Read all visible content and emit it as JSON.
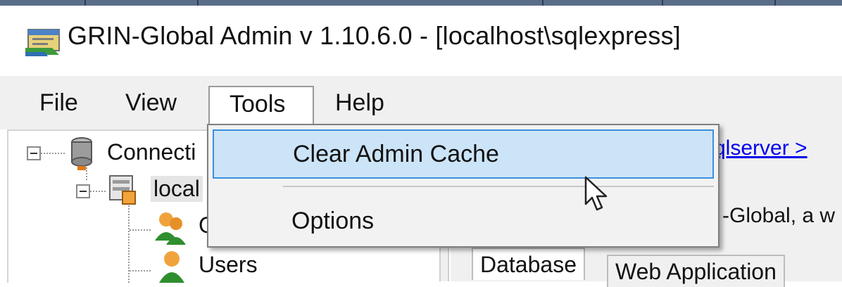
{
  "window": {
    "title": "GRIN-Global Admin v 1.10.6.0 - [localhost\\sqlexpress]"
  },
  "menubar": {
    "file": "File",
    "view": "View",
    "tools": "Tools",
    "help": "Help"
  },
  "tools_menu": {
    "items": [
      {
        "label": "Clear Admin Cache"
      },
      {
        "label": "Options"
      }
    ]
  },
  "tree": {
    "connections": "Connecti",
    "localhost": "local",
    "group_partial": "G",
    "users": "Users"
  },
  "right_panel": {
    "link": "qlserver >",
    "info": "-Global, a w",
    "tabs": [
      {
        "label": "Database"
      },
      {
        "label": "Web Application"
      }
    ]
  },
  "colors": {
    "highlight_bg": "#cce4f7",
    "highlight_border": "#3d8ee0",
    "menubar_bg": "#f0f0f0",
    "link": "#0000ee"
  },
  "icons": [
    "app-icon",
    "database-icon",
    "server-icon",
    "users-group-icon",
    "user-icon",
    "mouse-pointer-icon"
  ]
}
